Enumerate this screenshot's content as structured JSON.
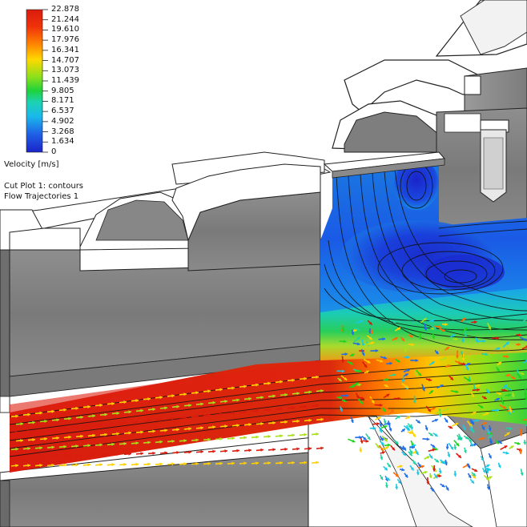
{
  "legend": {
    "ticks": [
      "22.878",
      "21.244",
      "19.610",
      "17.976",
      "16.341",
      "14.707",
      "13.073",
      "11.439",
      "9.805",
      "8.171",
      "6.537",
      "4.902",
      "3.268",
      "1.634",
      "0"
    ],
    "title": "Velocity [m/s]",
    "colors": [
      "#d91c0e",
      "#ff6a00",
      "#ffd000",
      "#a8e01a",
      "#1ed21e",
      "#20d2a0",
      "#1ac8e6",
      "#1f6ce8",
      "#1a23c8"
    ]
  },
  "plots": {
    "cut_plot": "Cut Plot 1: contours",
    "trajectories": "Flow Trajectories 1"
  }
}
